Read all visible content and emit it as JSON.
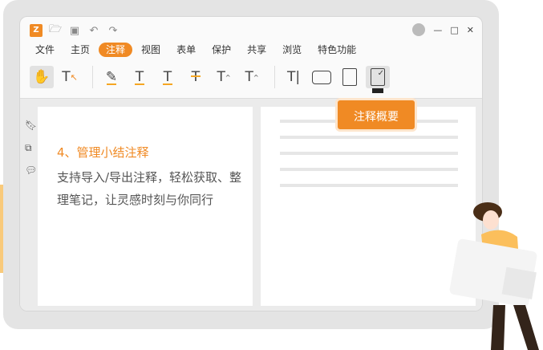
{
  "toolbar_quick": {
    "icons": [
      "open-folder-icon",
      "save-icon",
      "undo-icon",
      "redo-icon"
    ]
  },
  "menu": [
    "文件",
    "主页",
    "注释",
    "视图",
    "表单",
    "保护",
    "共享",
    "浏览",
    "特色功能"
  ],
  "active_menu": "注释",
  "tools": [
    "hand-icon",
    "select-text-icon",
    "highlight-icon",
    "wavy-underline-icon",
    "underline-icon",
    "strikethrough-icon",
    "replace-text-icon",
    "insert-text-icon",
    "textbox-icon",
    "rectangle-icon",
    "area-icon",
    "annotation-summary-icon"
  ],
  "tooltip": "注释概要",
  "slide": {
    "heading": "4、管理小结注释",
    "body": "支持导入/导出注释，轻松获取、整理笔记，让灵感时刻与你同行"
  },
  "colors": {
    "accent": "#f08a24"
  }
}
